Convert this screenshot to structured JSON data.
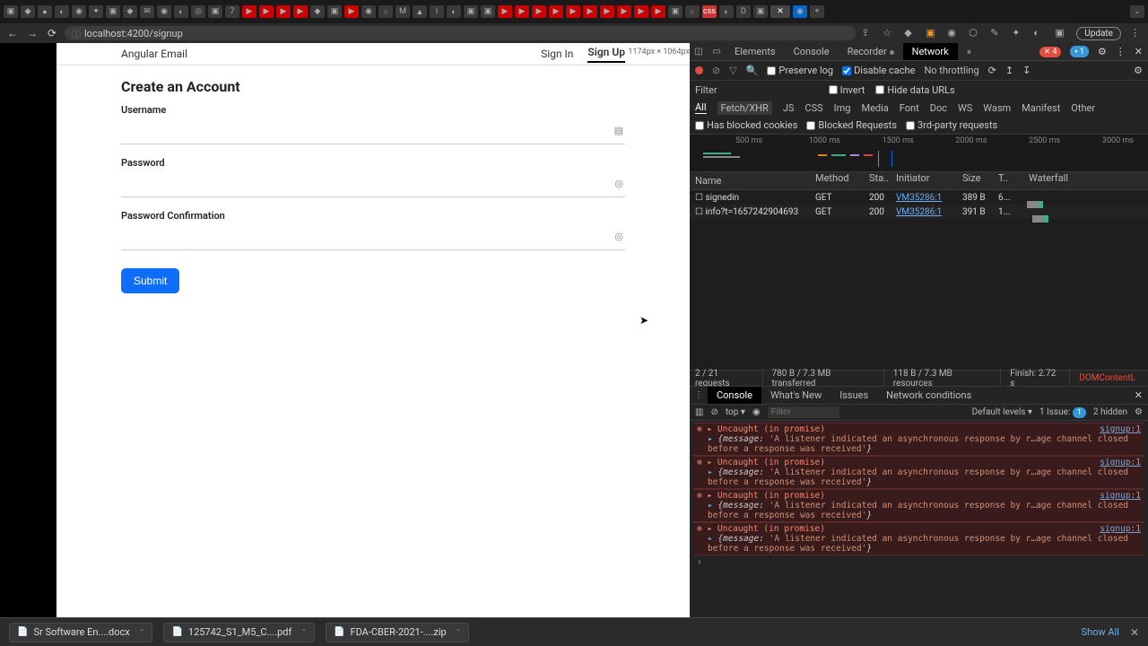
{
  "browser": {
    "url": "localhost:4200/signup",
    "update_label": "Update",
    "dimensions_overlay": "1174px × 1064px"
  },
  "page": {
    "brand": "Angular Email",
    "nav": {
      "signin": "Sign In",
      "signup": "Sign Up"
    },
    "title": "Create an Account",
    "labels": {
      "username": "Username",
      "password": "Password",
      "password_confirm": "Password Confirmation"
    },
    "submit": "Submit"
  },
  "devtools": {
    "tabs": {
      "elements": "Elements",
      "console": "Console",
      "recorder": "Recorder",
      "network": "Network"
    },
    "badges": {
      "errors": "4",
      "issues": "1"
    },
    "toolbar": {
      "preserve": "Preserve log",
      "disable_cache": "Disable cache",
      "throttling": "No throttling"
    },
    "filter": {
      "label": "Filter",
      "invert": "Invert",
      "hide_urls": "Hide data URLs",
      "types": [
        "All",
        "Fetch/XHR",
        "JS",
        "CSS",
        "Img",
        "Media",
        "Font",
        "Doc",
        "WS",
        "Wasm",
        "Manifest",
        "Other"
      ],
      "blocked_cookies": "Has blocked cookies",
      "blocked_requests": "Blocked Requests",
      "third_party": "3rd-party requests"
    },
    "timeline": {
      "ticks": [
        "500 ms",
        "1000 ms",
        "1500 ms",
        "2000 ms",
        "2500 ms",
        "3000 ms"
      ]
    },
    "table": {
      "headers": {
        "name": "Name",
        "method": "Method",
        "status": "Sta..",
        "initiator": "Initiator",
        "size": "Size",
        "time": "T..",
        "waterfall": "Waterfall"
      },
      "rows": [
        {
          "name": "signedin",
          "method": "GET",
          "status": "200",
          "initiator": "VM35286:1",
          "size": "389 B",
          "time": "6..."
        },
        {
          "name": "info?t=1657242904693",
          "method": "GET",
          "status": "200",
          "initiator": "VM35286:1",
          "size": "391 B",
          "time": "1..."
        }
      ]
    },
    "status": {
      "requests": "2 / 21 requests",
      "transferred": "780 B / 7.3 MB transferred",
      "resources": "118 B / 7.3 MB resources",
      "finish": "Finish: 2.72 s",
      "domload": "DOMContentL"
    },
    "console_drawer": {
      "tabs": {
        "console": "Console",
        "whatsnew": "What's New",
        "issues": "Issues",
        "netcond": "Network conditions"
      },
      "toolbar": {
        "context": "top",
        "filter_placeholder": "Filter",
        "levels": "Default levels",
        "issue_label": "1 Issue:",
        "issue_count": "1",
        "hidden": "2 hidden"
      },
      "errors": [
        {
          "head": "Uncaught (in promise)",
          "src": "signup:1",
          "body": "{message: 'A listener indicated an asynchronous response by r…age channel closed before a response was received'}"
        },
        {
          "head": "Uncaught (in promise)",
          "src": "signup:1",
          "body": "{message: 'A listener indicated an asynchronous response by r…age channel closed before a response was received'}"
        },
        {
          "head": "Uncaught (in promise)",
          "src": "signup:1",
          "body": "{message: 'A listener indicated an asynchronous response by r…age channel closed before a response was received'}"
        },
        {
          "head": "Uncaught (in promise)",
          "src": "signup:1",
          "body": "{message: 'A listener indicated an asynchronous response by r…age channel closed before a response was received'}"
        }
      ]
    }
  },
  "downloads": {
    "items": [
      {
        "name": "Sr Software En....docx"
      },
      {
        "name": "125742_S1_M5_C....pdf"
      },
      {
        "name": "FDA-CBER-2021-....zip"
      }
    ],
    "show_all": "Show All"
  }
}
